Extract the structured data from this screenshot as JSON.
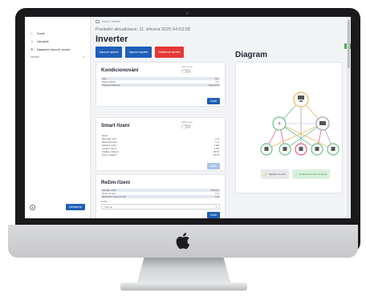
{
  "sidebar": {
    "items": [
      {
        "label": "Domů",
        "icon": "home-icon"
      },
      {
        "label": "Uživatelé",
        "icon": "users-icon"
      },
      {
        "label": "Nastavení fotovolt. panelu",
        "icon": "gear-icon"
      }
    ],
    "sub_label": "Invertér",
    "logout_label": "Odhlásit se",
    "user_icon": "user-icon"
  },
  "breadcrumb": {
    "text": "Domů / Invertér"
  },
  "header": {
    "updated": "Poslední aktualizace: 11. března 2025 04:53:28",
    "title": "Inverter"
  },
  "actions": {
    "btn1": "Zapnout systém",
    "btn2": "Vypnout systém",
    "btn3": "Resetovat systém"
  },
  "cards": {
    "conditioning": {
      "title": "Kondicionování",
      "toggle_label": "Aktivováno",
      "rows": [
        {
          "k": "Stav",
          "v": "Vyp."
        },
        {
          "k": "Napětí článku",
          "v": "0 V"
        },
        {
          "k": "Poslední kalibrace",
          "v": "Neprobíhá"
        }
      ],
      "save": "Uložit"
    },
    "smart": {
      "title": "Smart řízení",
      "toggle_label": "Aktivováno",
      "rows": [
        {
          "k": "Režim",
          "v": ""
        },
        {
          "k": "Minimální SoC",
          "v": "0 %"
        },
        {
          "k": "Maximální SoC",
          "v": "0 %"
        },
        {
          "k": "Nabíjecí výkon",
          "v": "0 kW"
        },
        {
          "k": "Vybíjecí výkon",
          "v": "0 kW"
        },
        {
          "k": "Začátek nabíjení",
          "v": "00:00"
        },
        {
          "k": "Konec nabíjení",
          "v": "00:00"
        }
      ],
      "save": "Uložit"
    },
    "mode": {
      "title": "Režim řízení",
      "rows": [
        {
          "k": "Aktuální režim",
          "v": "Self-use"
        },
        {
          "k": "Rezervní SoC",
          "v": "0 %"
        },
        {
          "k": "Maximální výkon do sítě",
          "v": "0 W"
        }
      ],
      "select_label": "Režim",
      "select_value": "Vyberte",
      "save": "Uložit"
    }
  },
  "diagram": {
    "title": "Diagram",
    "top_button": "+",
    "buttons": {
      "grey": "Nabíjení ze sítě",
      "green": "Dodávka do sítě povolena"
    }
  },
  "colors": {
    "primary": "#1f5fb8",
    "danger": "#e53935",
    "success": "#4caf50"
  }
}
